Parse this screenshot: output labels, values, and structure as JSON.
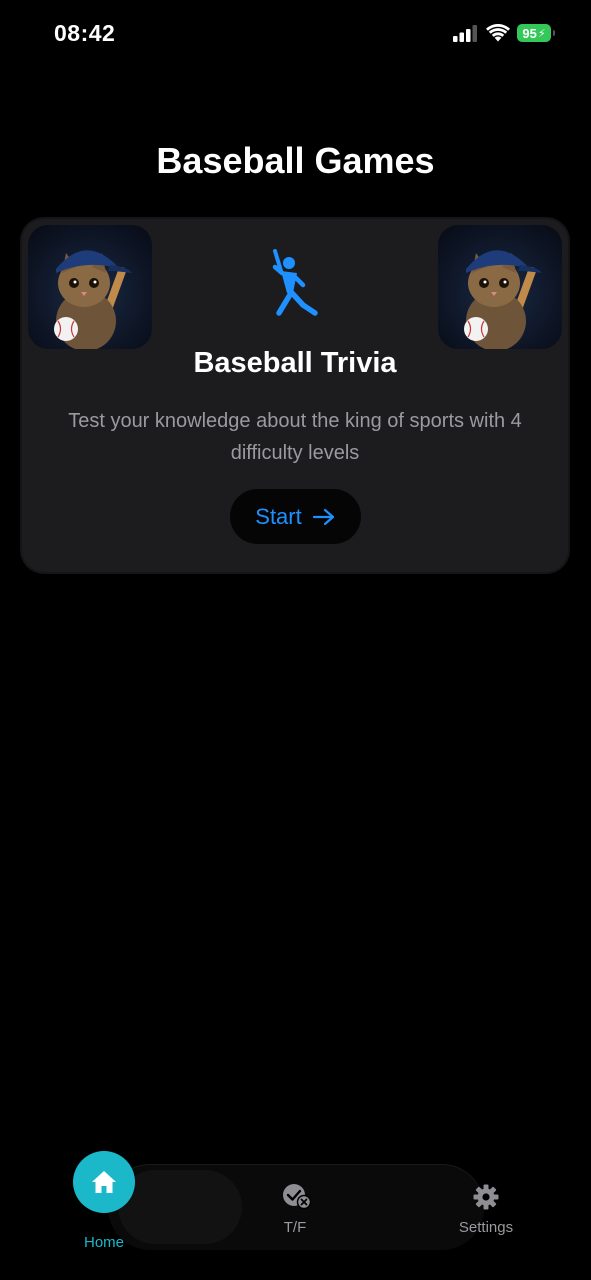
{
  "status_bar": {
    "time": "08:42",
    "battery": "95"
  },
  "page": {
    "title": "Baseball Games"
  },
  "game_card": {
    "title": "Baseball Trivia",
    "description": "Test your knowledge about the king of sports with 4 difficulty levels",
    "start_label": "Start",
    "accent_color": "#1e90ff",
    "icons": [
      "cat-baseball-image",
      "baseball-batter-icon",
      "arrow-right-icon"
    ]
  },
  "tab_bar": {
    "active_color": "#1bb8c9",
    "items": [
      {
        "label": "Home",
        "icon": "house-icon",
        "active": true
      },
      {
        "label": "T/F",
        "icon": "check-cross-icon",
        "active": false
      },
      {
        "label": "Settings",
        "icon": "gear-icon",
        "active": false
      }
    ]
  }
}
